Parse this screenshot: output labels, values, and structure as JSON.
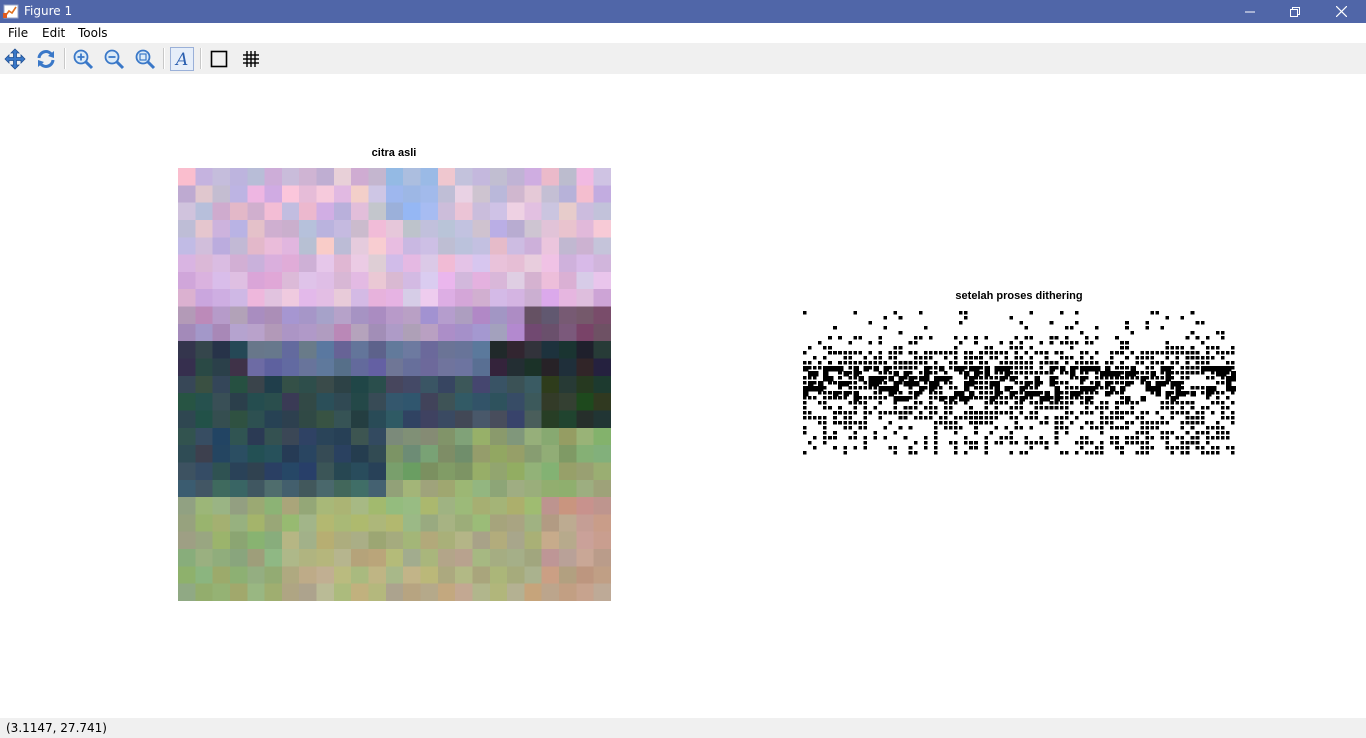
{
  "window": {
    "title": "Figure 1",
    "titlebar_color": "#5066a8",
    "controls": [
      "minimize-icon",
      "restore-icon",
      "close-icon"
    ]
  },
  "menu": {
    "items": [
      {
        "label": "File"
      },
      {
        "label": "Edit"
      },
      {
        "label": "Tools"
      }
    ]
  },
  "toolbar": {
    "tools": [
      "pan-icon",
      "rotate-icon",
      "zoom-in-icon",
      "zoom-out-icon",
      "zoom-region-icon",
      "text-tool-icon",
      "axes-box-icon",
      "grid-icon"
    ]
  },
  "figure": {
    "left_title": "citra asli",
    "right_title": "setelah proses dithering"
  },
  "status": {
    "coords": "(3.1147, 27.741)"
  }
}
